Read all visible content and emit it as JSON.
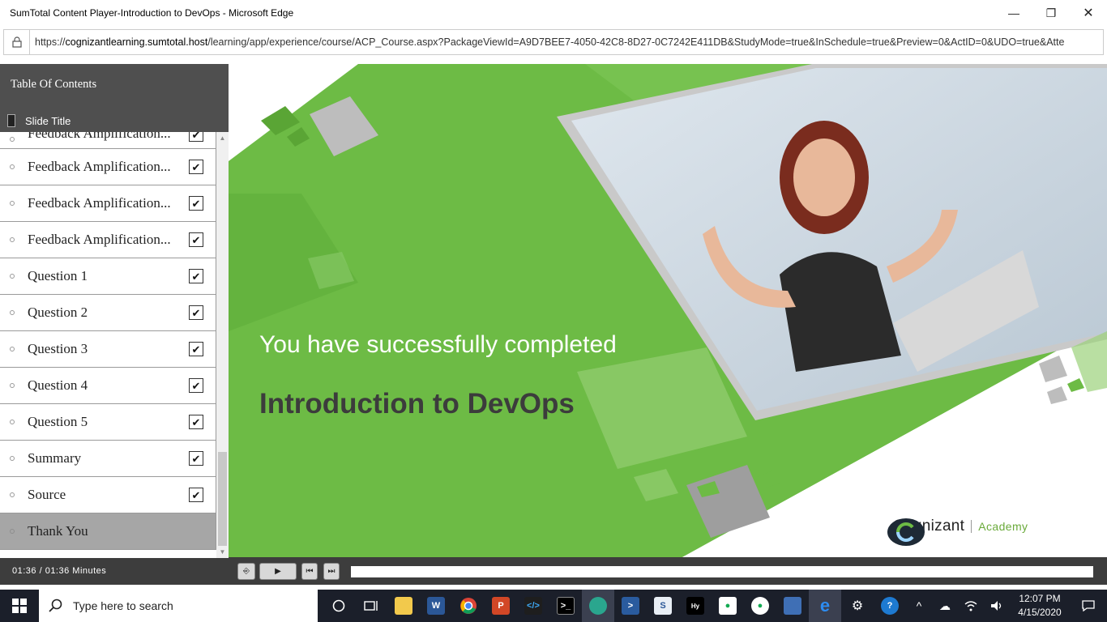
{
  "window": {
    "title": "SumTotal Content Player-Introduction to DevOps - Microsoft Edge",
    "minimize": "—",
    "restore": "❐",
    "close": "✕"
  },
  "address": {
    "url_prefix": "https://",
    "url_host": "cognizantlearning.sumtotal.host",
    "url_path": "/learning/app/experience/course/ACP_Course.aspx?PackageViewId=A9D7BEE7-4050-42C8-8D27-0C7242E411DB&StudyMode=true&InSchedule=true&Preview=0&ActID=0&UDO=true&Atte"
  },
  "toc": {
    "header": "Table Of Contents",
    "column_label": "Slide Title",
    "items": [
      {
        "label": "Feedback Amplification...",
        "checked": true
      },
      {
        "label": "Feedback Amplification...",
        "checked": true
      },
      {
        "label": "Feedback Amplification...",
        "checked": true
      },
      {
        "label": "Feedback Amplification...",
        "checked": true
      },
      {
        "label": "Question 1",
        "checked": true
      },
      {
        "label": "Question 2",
        "checked": true
      },
      {
        "label": "Question 3",
        "checked": true
      },
      {
        "label": "Question 4",
        "checked": true
      },
      {
        "label": "Question 5",
        "checked": true
      },
      {
        "label": "Summary",
        "checked": true
      },
      {
        "label": "Source",
        "checked": true
      },
      {
        "label": "Thank You",
        "checked": false,
        "active": true
      }
    ]
  },
  "slide": {
    "line1": "You have successfully completed",
    "line2": "Introduction to DevOps",
    "logo_brand": "Cognizant",
    "logo_sub": "Academy"
  },
  "controls": {
    "time": "01:36 / 01:36 Minutes",
    "progress": 1.0
  },
  "taskbar": {
    "search_placeholder": "Type here to search",
    "time": "12:07 PM",
    "date": "4/15/2020"
  },
  "colors": {
    "green": "#6dbb45",
    "dark_green": "#5aa535",
    "toc_dark": "#4f4f4f",
    "taskbar": "#1b1f2a"
  }
}
